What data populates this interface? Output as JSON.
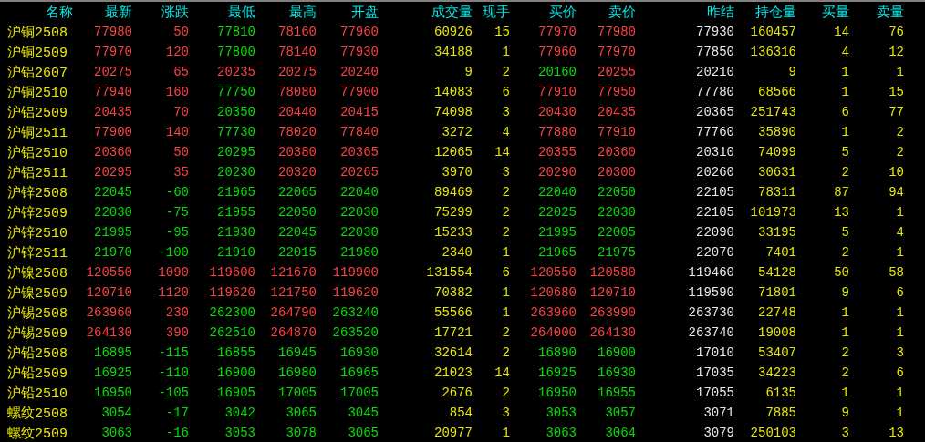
{
  "columns": [
    "名称",
    "最新",
    "涨跌",
    "最低",
    "最高",
    "开盘",
    "成交量",
    "现手",
    "买价",
    "卖价",
    "昨结",
    "持仓量",
    "买量",
    "卖量"
  ],
  "rows": [
    {
      "name": "沪铜",
      "code": "2508",
      "cells": [
        "77980",
        "50",
        "77810",
        "78160",
        "77960",
        "60926",
        "15",
        "77970",
        "77980",
        "77930",
        "160457",
        "14",
        "76"
      ]
    },
    {
      "name": "沪铜",
      "code": "2509",
      "cells": [
        "77970",
        "120",
        "77800",
        "78140",
        "77930",
        "34188",
        "1",
        "77960",
        "77970",
        "77850",
        "136316",
        "4",
        "12"
      ]
    },
    {
      "name": "沪铝",
      "code": "2607",
      "cells": [
        "20275",
        "65",
        "20235",
        "20275",
        "20240",
        "9",
        "2",
        "20160",
        "20255",
        "20210",
        "9",
        "1",
        "1"
      ]
    },
    {
      "name": "沪铜",
      "code": "2510",
      "cells": [
        "77940",
        "160",
        "77750",
        "78080",
        "77900",
        "14083",
        "6",
        "77910",
        "77950",
        "77780",
        "68566",
        "1",
        "15"
      ]
    },
    {
      "name": "沪铝",
      "code": "2509",
      "cells": [
        "20435",
        "70",
        "20350",
        "20440",
        "20415",
        "74098",
        "3",
        "20430",
        "20435",
        "20365",
        "251743",
        "6",
        "77"
      ]
    },
    {
      "name": "沪铜",
      "code": "2511",
      "cells": [
        "77900",
        "140",
        "77730",
        "78020",
        "77840",
        "3272",
        "4",
        "77880",
        "77910",
        "77760",
        "35890",
        "1",
        "2"
      ]
    },
    {
      "name": "沪铝",
      "code": "2510",
      "cells": [
        "20360",
        "50",
        "20295",
        "20380",
        "20365",
        "12065",
        "14",
        "20355",
        "20360",
        "20310",
        "74099",
        "5",
        "2"
      ]
    },
    {
      "name": "沪铝",
      "code": "2511",
      "cells": [
        "20295",
        "35",
        "20230",
        "20320",
        "20265",
        "3970",
        "3",
        "20290",
        "20300",
        "20260",
        "30631",
        "2",
        "10"
      ]
    },
    {
      "name": "沪锌",
      "code": "2508",
      "cells": [
        "22045",
        "-60",
        "21965",
        "22065",
        "22040",
        "89469",
        "2",
        "22040",
        "22050",
        "22105",
        "78311",
        "87",
        "94"
      ]
    },
    {
      "name": "沪锌",
      "code": "2509",
      "cells": [
        "22030",
        "-75",
        "21955",
        "22050",
        "22030",
        "75299",
        "2",
        "22025",
        "22030",
        "22105",
        "101973",
        "13",
        "1"
      ]
    },
    {
      "name": "沪锌",
      "code": "2510",
      "cells": [
        "21995",
        "-95",
        "21930",
        "22045",
        "22030",
        "15233",
        "2",
        "21995",
        "22005",
        "22090",
        "33195",
        "5",
        "4"
      ]
    },
    {
      "name": "沪锌",
      "code": "2511",
      "cells": [
        "21970",
        "-100",
        "21910",
        "22015",
        "21980",
        "2340",
        "1",
        "21965",
        "21975",
        "22070",
        "7401",
        "2",
        "1"
      ]
    },
    {
      "name": "沪镍",
      "code": "2508",
      "cells": [
        "120550",
        "1090",
        "119600",
        "121670",
        "119900",
        "131554",
        "6",
        "120550",
        "120580",
        "119460",
        "54128",
        "50",
        "58"
      ]
    },
    {
      "name": "沪镍",
      "code": "2509",
      "cells": [
        "120710",
        "1120",
        "119620",
        "121750",
        "119620",
        "70382",
        "1",
        "120680",
        "120710",
        "119590",
        "71801",
        "9",
        "6"
      ]
    },
    {
      "name": "沪锡",
      "code": "2508",
      "cells": [
        "263960",
        "230",
        "262300",
        "264790",
        "263240",
        "55566",
        "1",
        "263960",
        "263990",
        "263730",
        "22748",
        "1",
        "1"
      ]
    },
    {
      "name": "沪锡",
      "code": "2509",
      "cells": [
        "264130",
        "390",
        "262510",
        "264870",
        "263520",
        "17721",
        "2",
        "264000",
        "264130",
        "263740",
        "19008",
        "1",
        "1"
      ]
    },
    {
      "name": "沪铅",
      "code": "2508",
      "cells": [
        "16895",
        "-115",
        "16855",
        "16945",
        "16930",
        "32614",
        "2",
        "16890",
        "16900",
        "17010",
        "53407",
        "2",
        "3"
      ]
    },
    {
      "name": "沪铅",
      "code": "2509",
      "cells": [
        "16925",
        "-110",
        "16900",
        "16980",
        "16965",
        "21023",
        "14",
        "16925",
        "16930",
        "17035",
        "34223",
        "2",
        "6"
      ]
    },
    {
      "name": "沪铅",
      "code": "2510",
      "cells": [
        "16950",
        "-105",
        "16905",
        "17005",
        "17005",
        "2676",
        "2",
        "16950",
        "16955",
        "17055",
        "6135",
        "1",
        "1"
      ]
    },
    {
      "name": "螺纹",
      "code": "2508",
      "cells": [
        "3054",
        "-17",
        "3042",
        "3065",
        "3045",
        "854",
        "3",
        "3053",
        "3057",
        "3071",
        "7885",
        "9",
        "1"
      ]
    },
    {
      "name": "螺纹",
      "code": "2509",
      "cells": [
        "3063",
        "-16",
        "3053",
        "3078",
        "3065",
        "20977",
        "1",
        "3063",
        "3064",
        "3079",
        "250103",
        "3",
        "13"
      ]
    }
  ]
}
